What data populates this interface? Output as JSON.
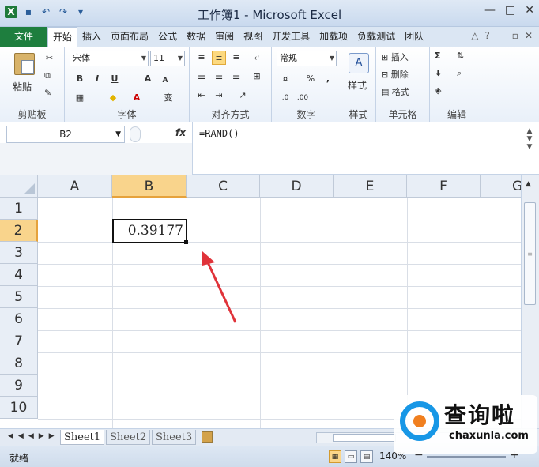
{
  "window": {
    "title": "工作簿1 - Microsoft Excel",
    "app_icon_label": "X",
    "qat_icons": [
      "save-icon",
      "undo-icon",
      "redo-icon",
      "customize-icon"
    ]
  },
  "ribbon_tabs": [
    "文件",
    "开始",
    "插入",
    "页面布局",
    "公式",
    "数据",
    "审阅",
    "视图",
    "开发工具",
    "加载项",
    "负载测试",
    "团队"
  ],
  "active_tab": "开始",
  "ribbon": {
    "clipboard": {
      "label": "剪贴板",
      "paste": "粘贴"
    },
    "font": {
      "label": "字体",
      "name": "宋体",
      "size": "11",
      "bold": "B",
      "italic": "I",
      "underline": "U",
      "grow": "A",
      "shrink": "A",
      "phonetic": "变"
    },
    "alignment": {
      "label": "对齐方式"
    },
    "number": {
      "label": "数字",
      "format": "常规",
      "percent": "%",
      "comma": ","
    },
    "styles": {
      "label": "样式",
      "button": "样式",
      "icon_glyph": "A"
    },
    "cells": {
      "label": "单元格",
      "insert": "插入",
      "delete": "删除",
      "format": "格式"
    },
    "editing": {
      "label": "编辑",
      "sum": "Σ"
    }
  },
  "formula_bar": {
    "name_box": "B2",
    "fx": "fx",
    "formula": "=RAND()"
  },
  "grid": {
    "columns": [
      "A",
      "B",
      "C",
      "D",
      "E",
      "F",
      "G"
    ],
    "rows": [
      "1",
      "2",
      "3",
      "4",
      "5",
      "6",
      "7",
      "8",
      "9",
      "10"
    ],
    "selected_column": "B",
    "selected_row": "2",
    "active_cell_value": "0.39177"
  },
  "sheets": [
    "Sheet1",
    "Sheet2",
    "Sheet3"
  ],
  "active_sheet": "Sheet1",
  "status": {
    "text": "就绪",
    "zoom": "140%"
  },
  "watermark": {
    "chinese": "查询啦",
    "domain": "chaxunla.com"
  },
  "colors": {
    "file_tab": "#1e7e3e",
    "selection_header": "#f9d48c",
    "annotation_arrow": "#e0333a"
  }
}
